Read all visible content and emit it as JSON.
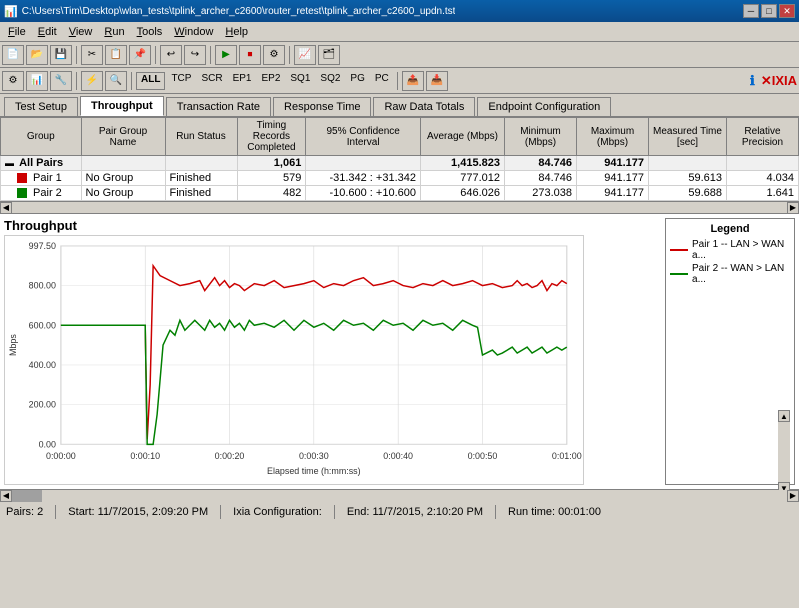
{
  "titleBar": {
    "text": "C:\\Users\\Tim\\Desktop\\wlan_tests\\tplink_archer_c2600\\router_retest\\tplink_archer_c2600_updn.tst",
    "minBtn": "─",
    "maxBtn": "□",
    "closeBtn": "✕"
  },
  "menuBar": {
    "items": [
      "File",
      "Edit",
      "View",
      "Run",
      "Tools",
      "Window",
      "Help"
    ]
  },
  "toolbar": {
    "protoButtons": [
      "ALL",
      "TCP",
      "SCR",
      "EP1",
      "EP2",
      "SQ1",
      "SQ2",
      "PG",
      "PC"
    ]
  },
  "tabs": {
    "items": [
      "Test Setup",
      "Throughput",
      "Transaction Rate",
      "Response Time",
      "Raw Data Totals",
      "Endpoint Configuration"
    ],
    "active": "Throughput"
  },
  "table": {
    "headers": [
      "Group",
      "Pair Group Name",
      "Run Status",
      "Timing Records Completed",
      "95% Confidence Interval",
      "Average (Mbps)",
      "Minimum (Mbps)",
      "Maximum (Mbps)",
      "Measured Time [sec]",
      "Relative Precision"
    ],
    "rows": [
      {
        "type": "all",
        "group": "All Pairs",
        "pairGroupName": "",
        "runStatus": "",
        "timingRecords": "1,061",
        "confidence": "",
        "average": "1,415.823",
        "minimum": "84.746",
        "maximum": "941.177",
        "measuredTime": "",
        "relativePrecision": ""
      },
      {
        "type": "pair",
        "index": 1,
        "group": "Pair 1",
        "pairGroupName": "No Group",
        "runStatus": "Finished",
        "timingRecords": "579",
        "confidence": "-31.342 : +31.342",
        "average": "777.012",
        "minimum": "84.746",
        "maximum": "941.177",
        "measuredTime": "59.613",
        "relativePrecision": "4.034",
        "color": "#cc0000"
      },
      {
        "type": "pair",
        "index": 2,
        "group": "Pair 2",
        "pairGroupName": "No Group",
        "runStatus": "Finished",
        "timingRecords": "482",
        "confidence": "-10.600 : +10.600",
        "average": "646.026",
        "minimum": "273.038",
        "maximum": "941.177",
        "measuredTime": "59.688",
        "relativePrecision": "1.641",
        "color": "#008000"
      }
    ]
  },
  "chart": {
    "title": "Throughput",
    "yLabel": "Mbps",
    "xLabel": "Elapsed time (h:mm:ss)",
    "yTicks": [
      "997.50",
      "800.00",
      "600.00",
      "400.00",
      "200.00",
      "0.00"
    ],
    "xTicks": [
      "0:00:00",
      "0:00:10",
      "0:00:20",
      "0:00:30",
      "0:00:40",
      "0:00:50",
      "0:01:00"
    ],
    "legend": {
      "title": "Legend",
      "items": [
        {
          "label": "Pair 1 -- LAN > WAN a...",
          "color": "#cc0000"
        },
        {
          "label": "Pair 2 -- WAN > LAN a...",
          "color": "#008000"
        }
      ]
    }
  },
  "statusBar": {
    "pairs": "Pairs: 2",
    "start": "Start: 11/7/2015, 2:09:20 PM",
    "ixiaConfig": "Ixia Configuration:",
    "end": "End: 11/7/2015, 2:10:20 PM",
    "runTime": "Run time: 00:01:00"
  }
}
